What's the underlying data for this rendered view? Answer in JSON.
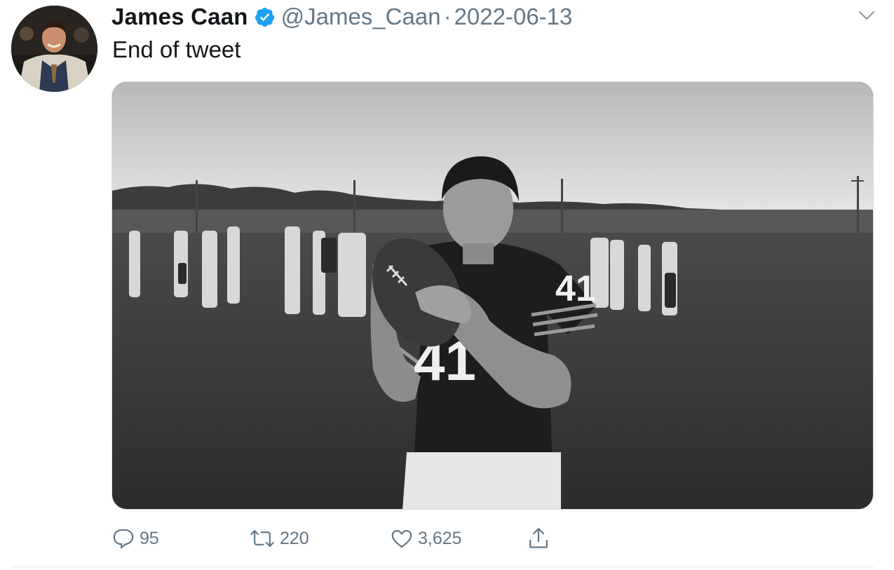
{
  "author": {
    "display_name": "James Caan",
    "handle": "@James_Caan",
    "separator": "·",
    "date": "2022-06-13",
    "verified": true,
    "avatar_icon": "avatar-photo"
  },
  "tweet": {
    "text": "End of tweet",
    "media_icon": "black-and-white-photo"
  },
  "actions": {
    "reply_count": "95",
    "retweet_count": "220",
    "like_count": "3,625"
  },
  "colors": {
    "text_primary": "#14171a",
    "text_secondary": "#657786",
    "verified_blue": "#1da1f2",
    "divider": "#e1e8ed"
  }
}
